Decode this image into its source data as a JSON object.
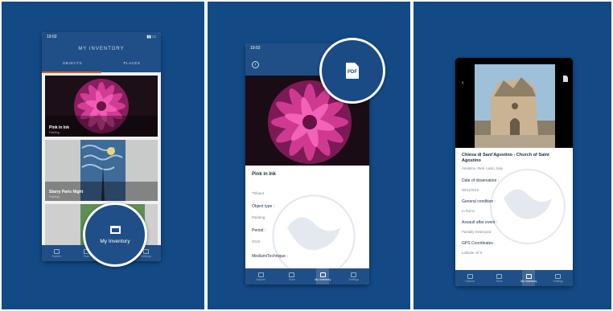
{
  "phone1": {
    "status_time": "19:02",
    "title": "MY INVENTORY",
    "tabs": [
      "OBJECTS",
      "PLACES"
    ],
    "cards": [
      {
        "title": "Pink in Ink",
        "subtitle": "Painting"
      },
      {
        "title": "Starry Paris Night",
        "subtitle": "Painting"
      },
      {
        "title": "",
        "subtitle": ""
      }
    ],
    "nav": [
      {
        "label": "Explore"
      },
      {
        "label": "Scan"
      },
      {
        "label": "My Inventory"
      },
      {
        "label": "Settings"
      }
    ],
    "magnified_label": "My Inventory"
  },
  "phone2": {
    "status_time": "19:02",
    "back_glyph": "‹",
    "pdf_label": "PDF",
    "object_title": "Pink in Ink",
    "object_subtitle": "Thibaut",
    "fields": [
      {
        "label": "Object type :",
        "value": "Painting"
      },
      {
        "label": "Period :",
        "value": "2018"
      },
      {
        "label": "Medium/Technique :",
        "value": ""
      }
    ],
    "nav": [
      {
        "label": "Explore"
      },
      {
        "label": "Scan"
      },
      {
        "label": "My Inventory"
      },
      {
        "label": "Settings"
      }
    ]
  },
  "phone3": {
    "back_glyph": "‹",
    "place_title": "Chiesa di Sant'Agostino - Church of Saint Agostino",
    "place_location": "Amatrice, Rieti, Lazio, Italy",
    "fields": [
      {
        "label": "Date of observation :",
        "value": "08/11/2016"
      },
      {
        "label": "General condition :",
        "value": "In Ruins"
      },
      {
        "label": "Assault after event :",
        "value": "Partially Destroyed"
      },
      {
        "label": "GPS Coordinates :",
        "value": "Latitude     42°6"
      }
    ],
    "nav": [
      {
        "label": "Explore"
      },
      {
        "label": "Scan"
      },
      {
        "label": "My Inventory"
      },
      {
        "label": "Settings"
      }
    ]
  },
  "colors": {
    "background": "#134a86",
    "header": "#1f4f86",
    "accent": "#e35b2a",
    "white": "#ffffff"
  }
}
